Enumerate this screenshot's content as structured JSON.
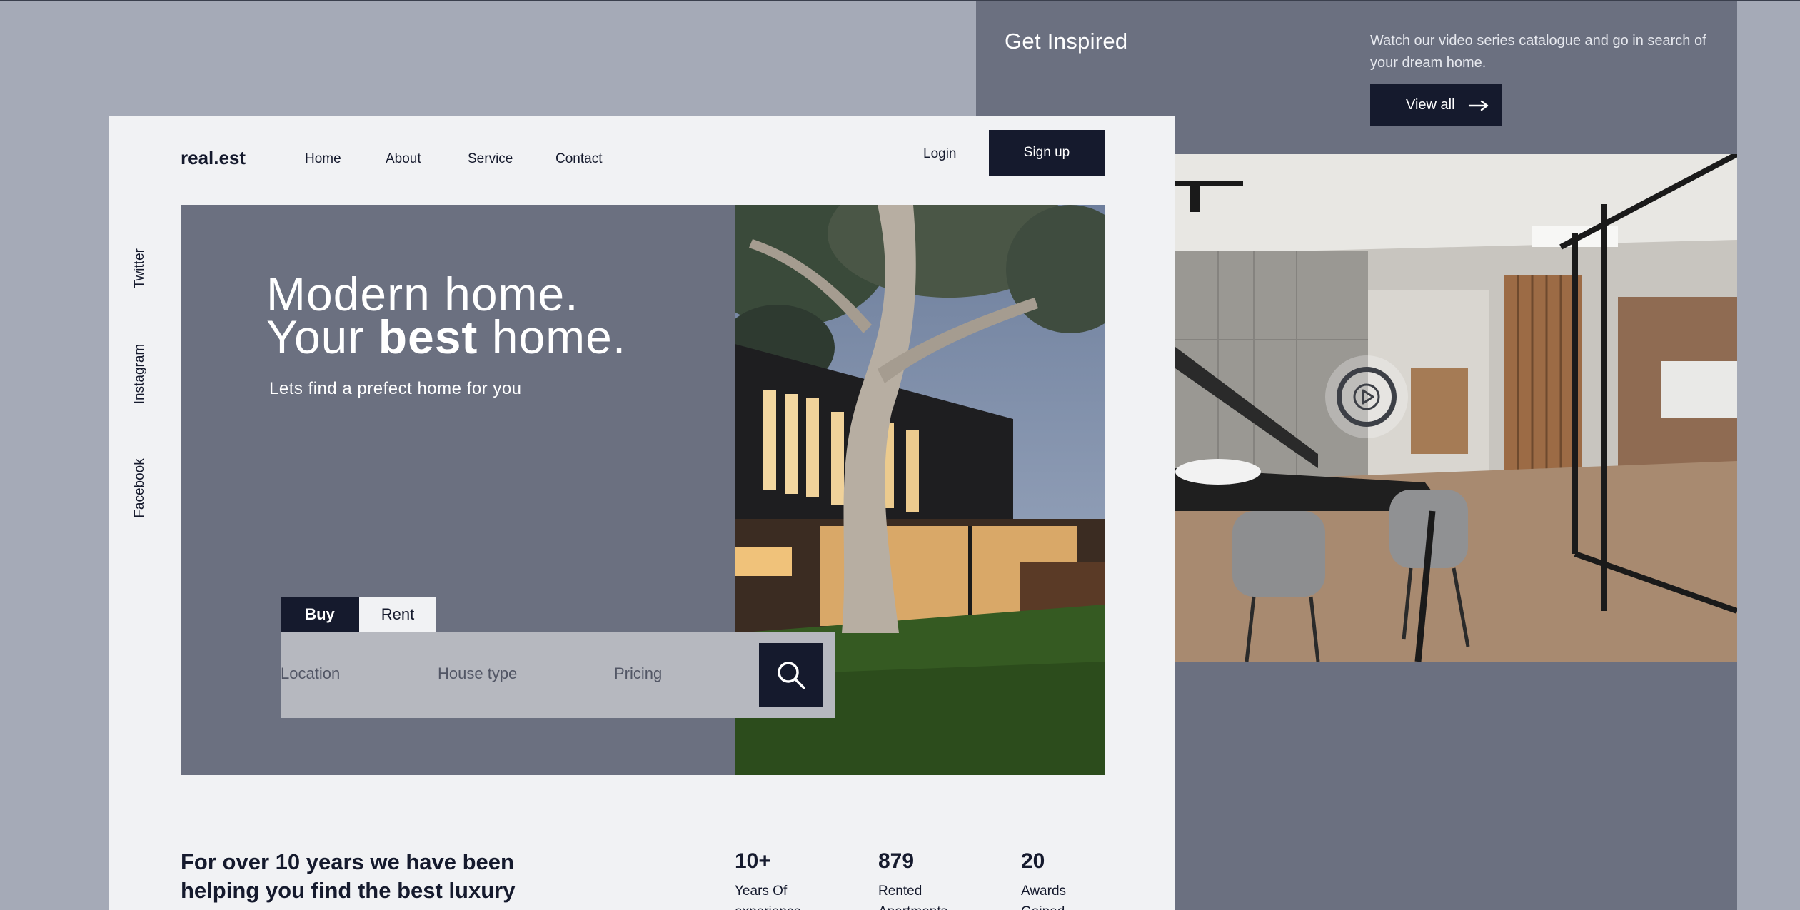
{
  "inspire": {
    "title": "Get Inspired",
    "description": "Watch our video series catalogue and go in search of your dream home.",
    "view_all": "View all"
  },
  "header": {
    "logo": "real.est",
    "nav": [
      "Home",
      "About",
      "Service",
      "Contact"
    ],
    "login": "Login",
    "signup": "Sign up"
  },
  "social": [
    "Twitter",
    "Instagram",
    "Facebook"
  ],
  "hero": {
    "title_line1": "Modern home.",
    "title_line2_pre": "Your",
    "title_line2_bold": "best",
    "title_line2_post": "home.",
    "subtitle": "Lets find a prefect home for you"
  },
  "search": {
    "tabs": [
      "Buy",
      "Rent"
    ],
    "active_tab": "Buy",
    "location_placeholder": "Location",
    "house_type_placeholder": "House type",
    "pricing_placeholder": "Pricing"
  },
  "about": {
    "heading": "For over 10 years we have been helping you find the best luxury"
  },
  "stats": [
    {
      "value": "10+",
      "label": "Years Of experience"
    },
    {
      "value": "879",
      "label": "Rented Apartments"
    },
    {
      "value": "20",
      "label": "Awards Gained"
    }
  ],
  "colors": {
    "page_bg": "#a5aab7",
    "panel": "#6b7080",
    "dark": "#151a2d",
    "card": "#f1f2f4"
  }
}
